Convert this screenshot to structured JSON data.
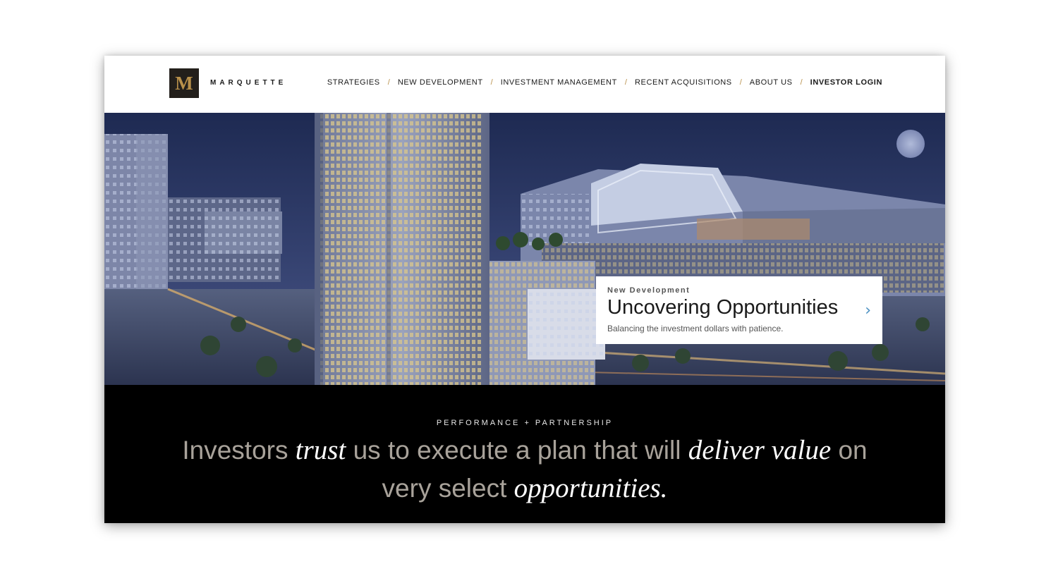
{
  "brand": {
    "logo_letter": "M",
    "name": "MARQUETTE",
    "accent": "#b8904a"
  },
  "nav": {
    "items": [
      {
        "label": "STRATEGIES"
      },
      {
        "label": "NEW DEVELOPMENT"
      },
      {
        "label": "INVESTMENT MANAGEMENT"
      },
      {
        "label": "RECENT ACQUISITIONS"
      },
      {
        "label": "ABOUT US"
      },
      {
        "label": "INVESTOR LOGIN"
      }
    ],
    "separator": "/"
  },
  "hero": {
    "callout": {
      "eyebrow": "New Development",
      "title": "Uncovering Opportunities",
      "subtitle": "Balancing the investment dollars with patience.",
      "arrow_icon": "chevron-right-icon",
      "arrow_glyph": "›",
      "arrow_color": "#4a90c2"
    }
  },
  "band": {
    "eyebrow": "PERFORMANCE + PARTNERSHIP",
    "line1": {
      "a": "Investors ",
      "b": "trust",
      "c": " us to execute a plan that will ",
      "d": "deliver value",
      "e": " on"
    },
    "line2": {
      "a": "very select ",
      "b": "opportunities."
    }
  }
}
